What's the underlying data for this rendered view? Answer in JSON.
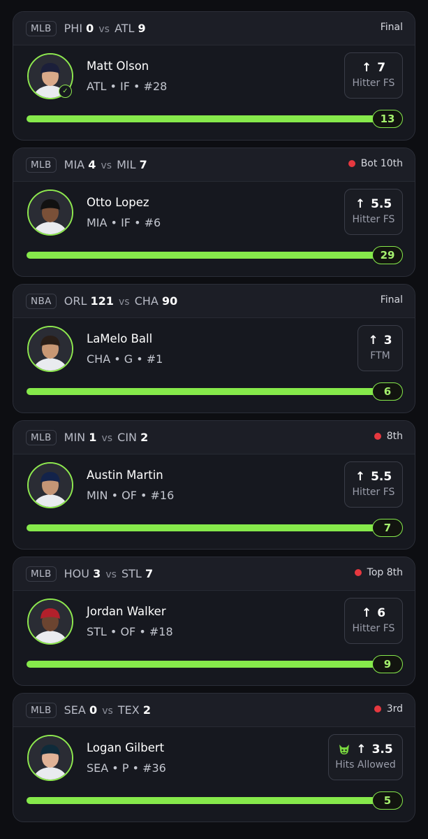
{
  "cards": [
    {
      "league": "MLB",
      "away": "PHI",
      "away_score": "0",
      "vs": "vs",
      "home": "ATL",
      "home_score": "9",
      "status": "Final",
      "live": false,
      "player": "Matt Olson",
      "meta": "ATL • IF • #28",
      "verified": true,
      "line": "7",
      "stat": "Hitter FS",
      "demon": false,
      "count": "13",
      "progress": 1.0,
      "cap_color": "#1b1f3a",
      "skin": "#d9a98a"
    },
    {
      "league": "MLB",
      "away": "MIA",
      "away_score": "4",
      "vs": "vs",
      "home": "MIL",
      "home_score": "7",
      "status": "Bot 10th",
      "live": true,
      "player": "Otto Lopez",
      "meta": "MIA • IF • #6",
      "verified": false,
      "line": "5.5",
      "stat": "Hitter FS",
      "demon": false,
      "count": "29",
      "progress": 1.0,
      "cap_color": "#111111",
      "skin": "#7a5038"
    },
    {
      "league": "NBA",
      "away": "ORL",
      "away_score": "121",
      "vs": "vs",
      "home": "CHA",
      "home_score": "90",
      "status": "Final",
      "live": false,
      "player": "LaMelo Ball",
      "meta": "CHA • G • #1",
      "verified": false,
      "line": "3",
      "stat": "FTM",
      "demon": false,
      "count": "6",
      "progress": 1.0,
      "cap_color": "#2a1e17",
      "skin": "#c99874"
    },
    {
      "league": "MLB",
      "away": "MIN",
      "away_score": "1",
      "vs": "vs",
      "home": "CIN",
      "home_score": "2",
      "status": "8th",
      "live": true,
      "player": "Austin Martin",
      "meta": "MIN • OF • #16",
      "verified": false,
      "line": "5.5",
      "stat": "Hitter FS",
      "demon": false,
      "count": "7",
      "progress": 1.0,
      "cap_color": "#13234a",
      "skin": "#c49576"
    },
    {
      "league": "MLB",
      "away": "HOU",
      "away_score": "3",
      "vs": "vs",
      "home": "STL",
      "home_score": "7",
      "status": "Top 8th",
      "live": true,
      "player": "Jordan Walker",
      "meta": "STL • OF • #18",
      "verified": false,
      "line": "6",
      "stat": "Hitter FS",
      "demon": false,
      "count": "9",
      "progress": 1.0,
      "cap_color": "#b3202b",
      "skin": "#6b4430"
    },
    {
      "league": "MLB",
      "away": "SEA",
      "away_score": "0",
      "vs": "vs",
      "home": "TEX",
      "home_score": "2",
      "status": "3rd",
      "live": true,
      "player": "Logan Gilbert",
      "meta": "SEA • P • #36",
      "verified": false,
      "line": "3.5",
      "stat": "Hits Allowed",
      "demon": true,
      "count": "5",
      "progress": 1.0,
      "cap_color": "#0f2b3a",
      "skin": "#e0b397"
    }
  ],
  "icons": {
    "arrow": "arrow-up-icon",
    "live": "live-dot-icon",
    "demon": "demon-icon",
    "check": "check-icon"
  },
  "colors": {
    "accent": "#86e94b",
    "live": "#e6383f",
    "card": "#16181f",
    "background": "#0d0e12"
  }
}
